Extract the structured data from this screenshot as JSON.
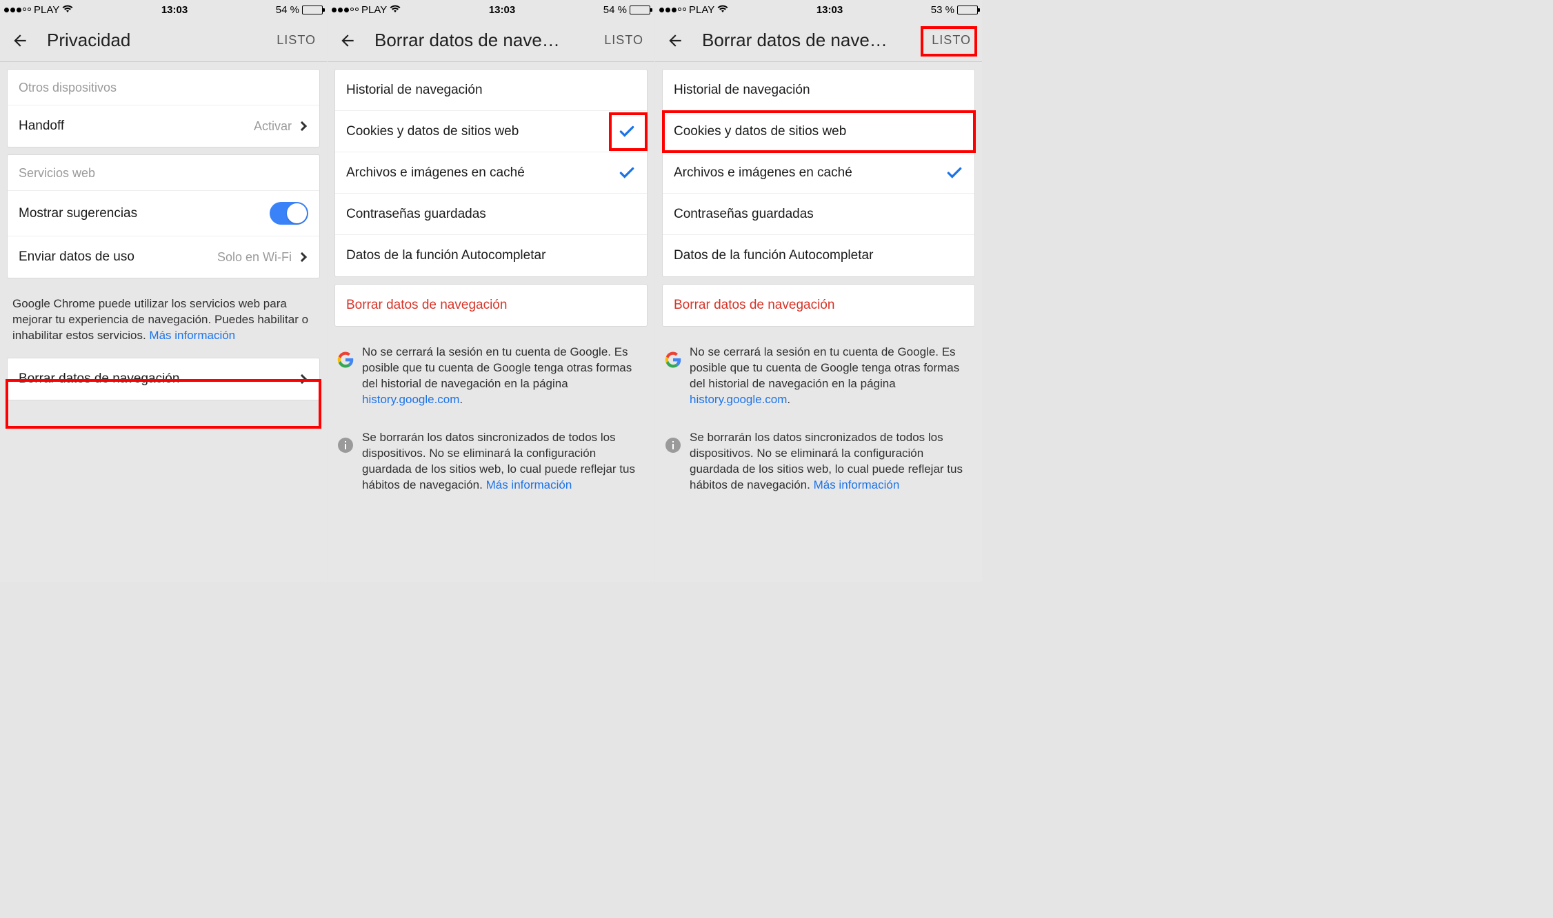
{
  "screens": [
    {
      "status": {
        "carrier": "PLAY",
        "time": "13:03",
        "battery_pct": "54 %",
        "battery_fill": 54
      },
      "nav": {
        "title": "Privacidad",
        "done": "LISTO"
      },
      "section1_header": "Otros dispositivos",
      "handoff": {
        "label": "Handoff",
        "value": "Activar"
      },
      "section2_header": "Servicios web",
      "suggestions_label": "Mostrar sugerencias",
      "usage": {
        "label": "Enviar datos de uso",
        "value": "Solo en Wi-Fi"
      },
      "footer_text": "Google Chrome puede utilizar los servicios web para mejorar tu experiencia de navegación. Puedes habilitar o inhabilitar estos servicios. ",
      "footer_link": "Más información",
      "clear_label": "Borrar datos de navegación"
    },
    {
      "status": {
        "carrier": "PLAY",
        "time": "13:03",
        "battery_pct": "54 %",
        "battery_fill": 54
      },
      "nav": {
        "title": "Borrar datos de nave…",
        "done": "LISTO"
      },
      "items": [
        {
          "label": "Historial de navegación",
          "checked": false
        },
        {
          "label": "Cookies y datos de sitios web",
          "checked": true
        },
        {
          "label": "Archivos e imágenes en caché",
          "checked": true
        },
        {
          "label": "Contraseñas guardadas",
          "checked": false
        },
        {
          "label": "Datos de la función Autocompletar",
          "checked": false
        }
      ],
      "clear_action": "Borrar datos de navegación",
      "note1": "No se cerrará la sesión en tu cuenta de Google. Es posible que tu cuenta de Google tenga otras formas del historial de navegación en la página ",
      "note1_link": "history.google.com",
      "note2": "Se borrarán los datos sincronizados de todos los dispositivos. No se eliminará la configuración guardada de los sitios web, lo cual puede reflejar tus hábitos de navegación. ",
      "note2_link": "Más información"
    },
    {
      "status": {
        "carrier": "PLAY",
        "time": "13:03",
        "battery_pct": "53 %",
        "battery_fill": 53
      },
      "nav": {
        "title": "Borrar datos de nave…",
        "done": "LISTO"
      },
      "items": [
        {
          "label": "Historial de navegación",
          "checked": false
        },
        {
          "label": "Cookies y datos de sitios web",
          "checked": false
        },
        {
          "label": "Archivos e imágenes en caché",
          "checked": true
        },
        {
          "label": "Contraseñas guardadas",
          "checked": false
        },
        {
          "label": "Datos de la función Autocompletar",
          "checked": false
        }
      ],
      "clear_action": "Borrar datos de navegación",
      "note1": "No se cerrará la sesión en tu cuenta de Google. Es posible que tu cuenta de Google tenga otras formas del historial de navegación en la página ",
      "note1_link": "history.google.com",
      "note2": "Se borrarán los datos sincronizados de todos los dispositivos. No se eliminará la configuración guardada de los sitios web, lo cual puede reflejar tus hábitos de navegación. ",
      "note2_link": "Más información"
    }
  ]
}
